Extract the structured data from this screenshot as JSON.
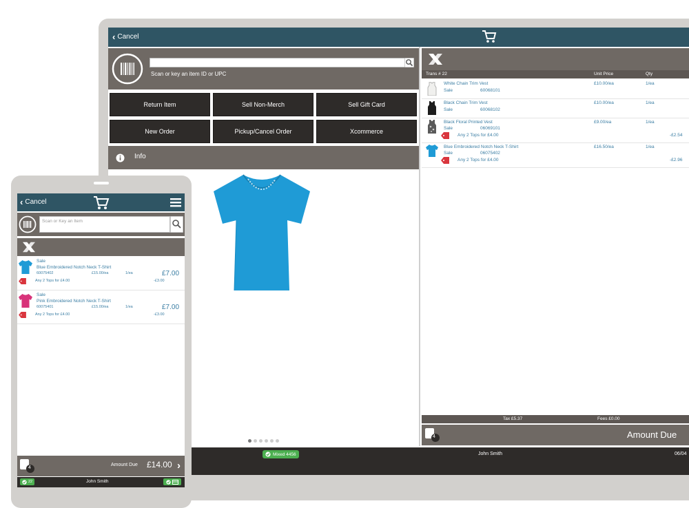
{
  "tablet": {
    "cancel_label": "Cancel",
    "scan_placeholder": "Scan or key an item ID or UPC",
    "buttons": [
      "Return Item",
      "Sell Non-Merch",
      "Sell Gift Card",
      "New Order",
      "Pickup/Cancel Order",
      "Xcommerce"
    ],
    "info_label": "Info",
    "basket": {
      "header_items": "Trans # 22",
      "header_price": "Unit Price",
      "header_qty": "Qty",
      "items": [
        {
          "name": "White Chain Trim Vest",
          "status": "Sale",
          "id": "60068101",
          "price": "£10.00/ea",
          "qty": "1/ea",
          "promo": "",
          "promo_amount": "",
          "icon": "vest-white-icon"
        },
        {
          "name": "Black Chain Trim Vest",
          "status": "Sale",
          "id": "60068102",
          "price": "£10.00/ea",
          "qty": "1/ea",
          "promo": "",
          "promo_amount": "",
          "icon": "vest-black-icon"
        },
        {
          "name": "Black Floral Printed Vest",
          "status": "Sale",
          "id": "06069101",
          "price": "£9.00/ea",
          "qty": "1/ea",
          "promo": "Any 2 Tops for £4.00",
          "promo_amount": "-£2.54",
          "icon": "vest-floral-icon"
        },
        {
          "name": "Blue Embroidered Notch Neck T-Shirt",
          "status": "Sale",
          "id": "06075402",
          "price": "£16.50/ea",
          "qty": "1/ea",
          "promo": "Any 2 Tops for £4.00",
          "promo_amount": "-£2.96",
          "icon": "tshirt-blue-icon"
        }
      ],
      "tax": "Tax £5.37",
      "fees": "Fees £0.00",
      "amount_due": "Amount Due",
      "badge": "4"
    },
    "footer": {
      "status": "Mixed 4456",
      "user": "John Smith",
      "date": "06/04"
    }
  },
  "phone": {
    "cancel_label": "Cancel",
    "scan_placeholder": "Scan or Key an Item",
    "items": [
      {
        "status": "Sale",
        "name": "Blue Embroidered Notch Neck T-Shirt",
        "id": "60075402",
        "price": "£15.00/ea",
        "qty": "1/ea",
        "total": "£7.00",
        "promo": "Any 2 Tops for £4.00",
        "promo_amount": "-£3.00",
        "icon": "tshirt-blue-icon"
      },
      {
        "status": "Sale",
        "name": "Pink Embroidered Notch Neck T-Shirt",
        "id": "60075401",
        "price": "£15.00/ea",
        "qty": "1/ea",
        "total": "£7.00",
        "promo": "Any 2 Tops for £4.00",
        "promo_amount": "-£3.00",
        "icon": "tshirt-pink-icon"
      }
    ],
    "amount_due_label": "Amount Due",
    "amount_due_value": "£14.00",
    "badge": "4",
    "user": "John Smith",
    "left_status": "22"
  },
  "colors": {
    "topbar": "#2f5564",
    "gray_panel": "#6f6964",
    "dark_button": "#2e2b29",
    "link_blue": "#3a7da3",
    "tshirt_blue": "#1f9bd6",
    "tshirt_pink": "#d8337a",
    "status_green": "#4caf50"
  }
}
